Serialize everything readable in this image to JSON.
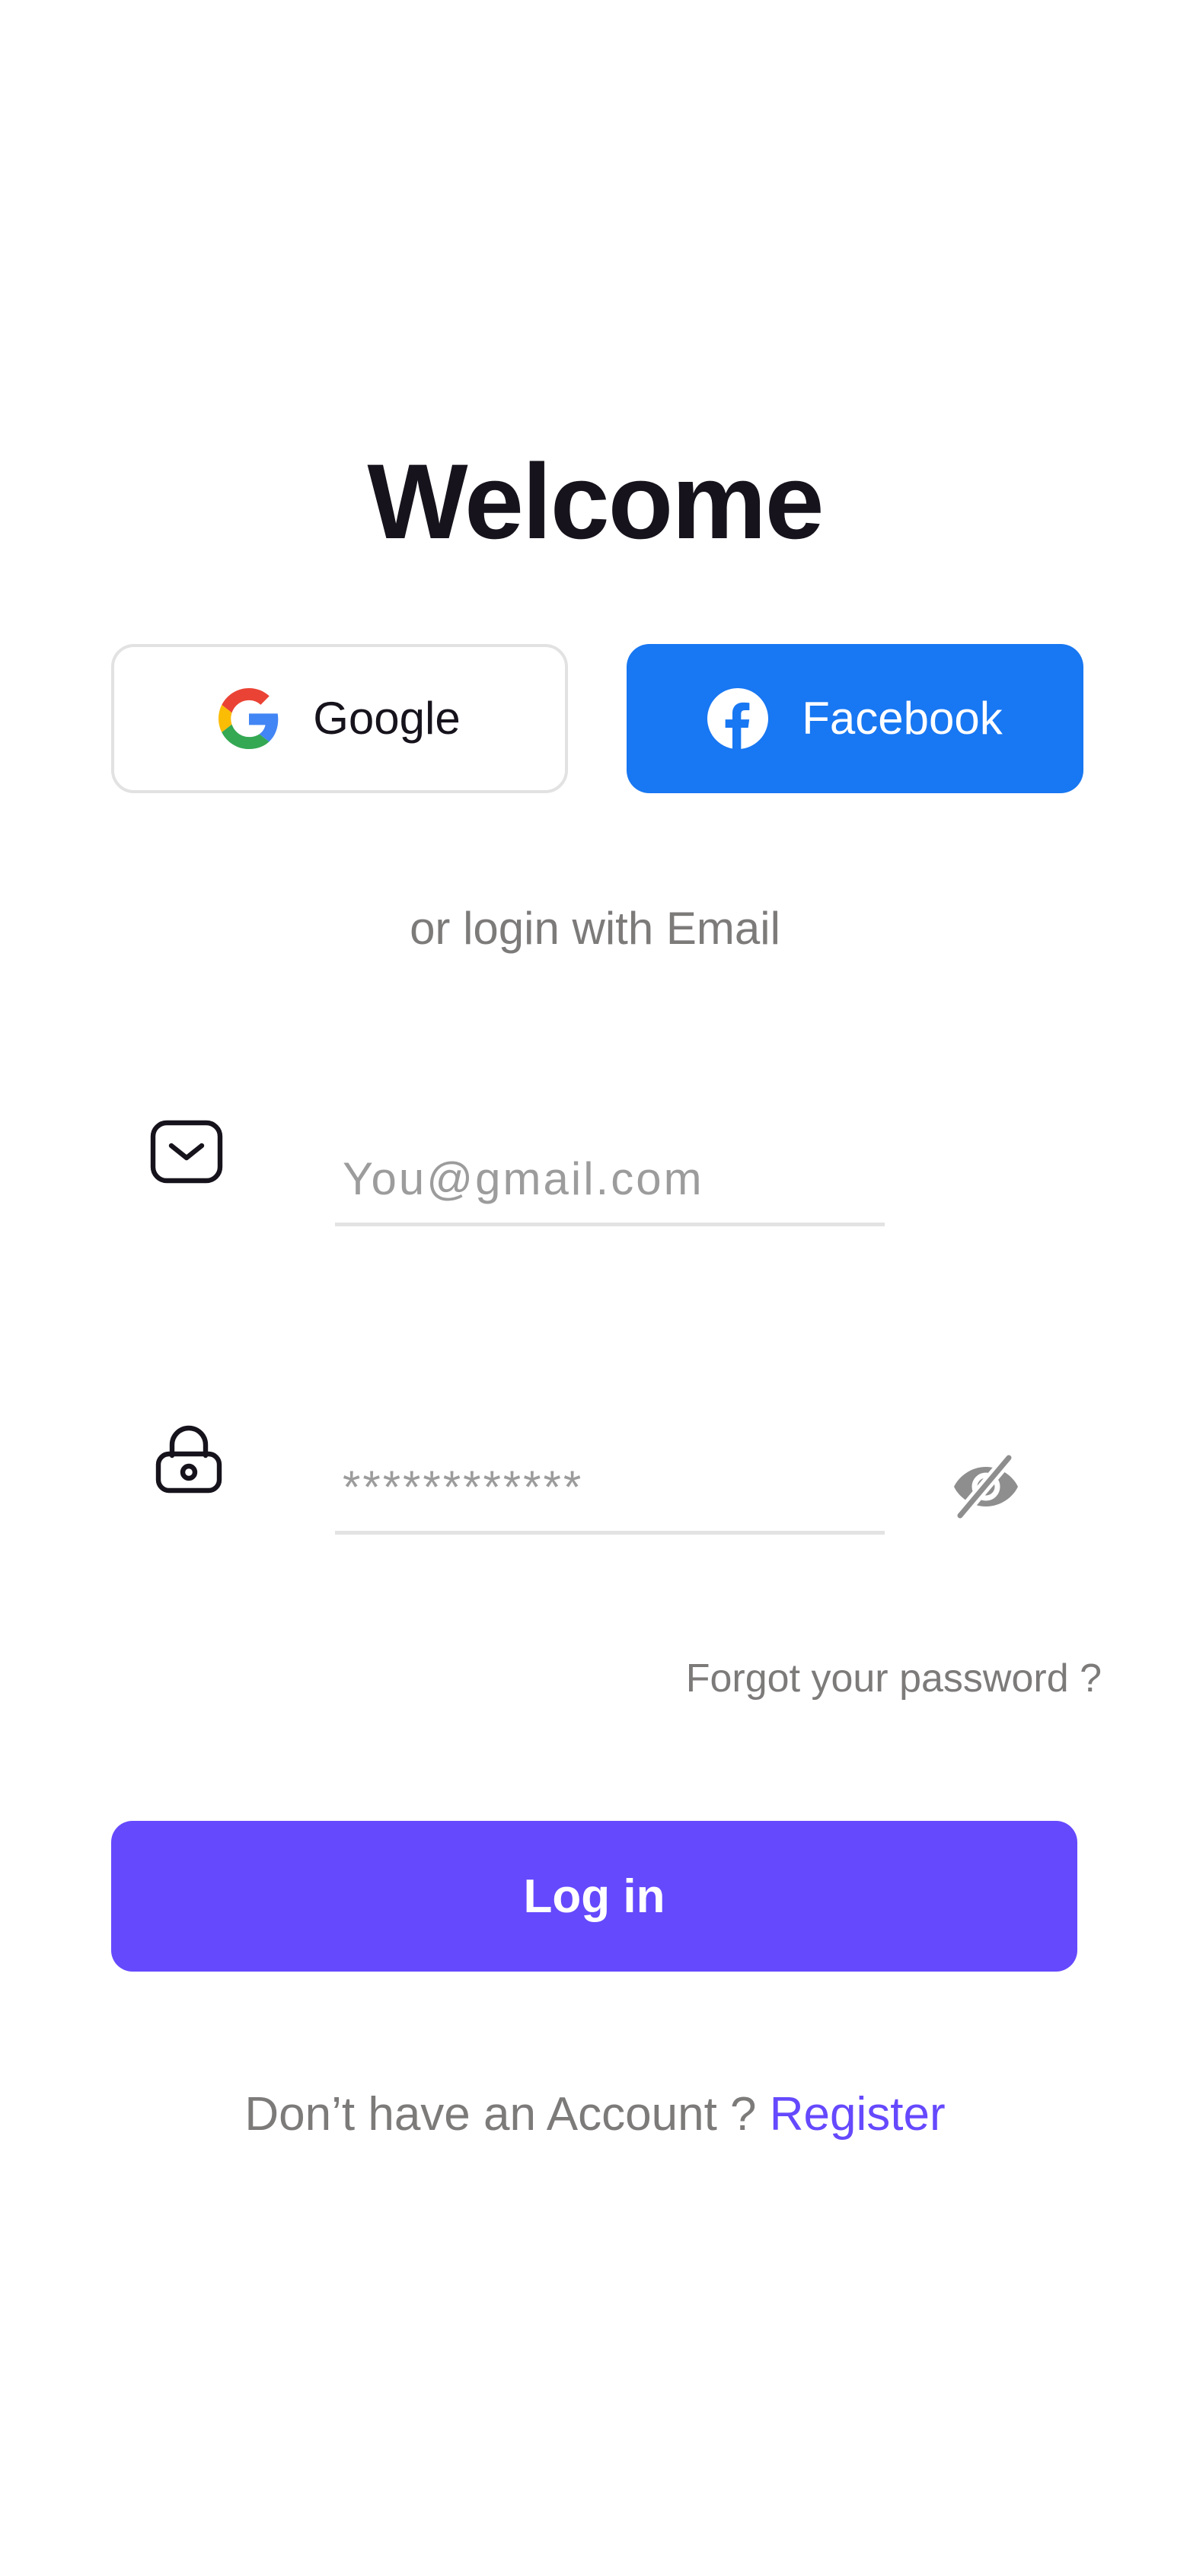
{
  "header": {
    "title": "Welcome"
  },
  "social": {
    "google": {
      "label": "Google",
      "icon": "google-icon"
    },
    "facebook": {
      "label": "Facebook",
      "icon": "facebook-icon",
      "color": "#1877f2"
    }
  },
  "divider_text": "or login with Email",
  "form": {
    "email": {
      "icon": "mail-icon",
      "value": "",
      "placeholder": "You@gmail.com"
    },
    "password": {
      "icon": "lock-icon",
      "value": "",
      "placeholder": "************",
      "visibility_icon": "eye-off-icon"
    },
    "forgot_password": "Forgot your password ?",
    "submit_label": "Log in"
  },
  "footer": {
    "prompt": "Don’t have an Account ? ",
    "register_label": "Register"
  },
  "colors": {
    "accent": "#6549fd",
    "facebook": "#1877f2",
    "title": "#17131c",
    "muted": "#7d7a7a",
    "field_border": "#e3e3e3"
  }
}
